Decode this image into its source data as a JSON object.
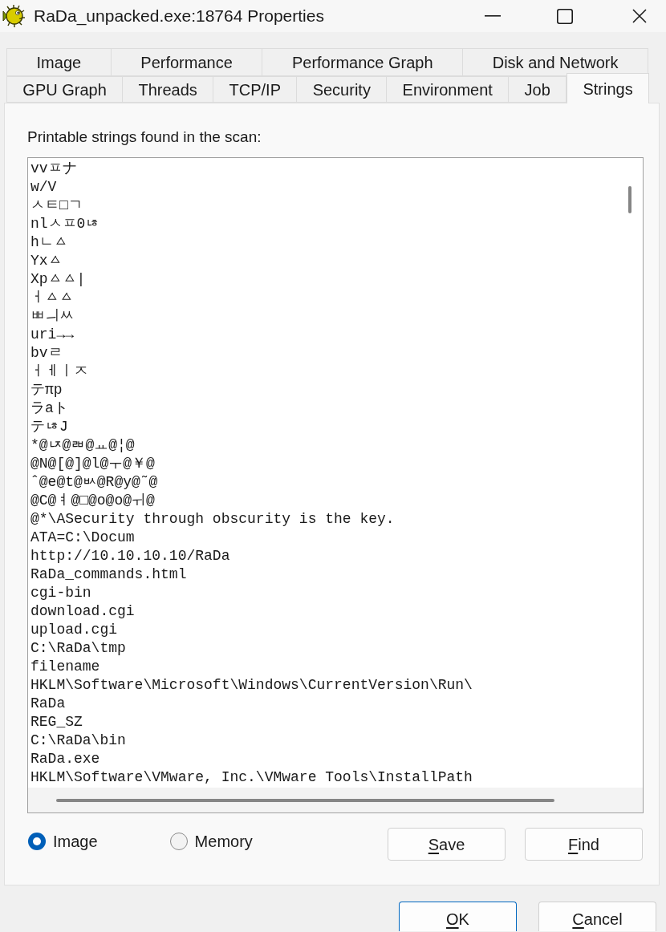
{
  "window": {
    "title": "RaDa_unpacked.exe:18764 Properties"
  },
  "tab_rows": [
    {
      "tabs": [
        {
          "label": "Image",
          "selected": false
        },
        {
          "label": "Performance",
          "selected": false
        },
        {
          "label": "Performance Graph",
          "selected": false
        },
        {
          "label": "Disk and Network",
          "selected": false
        }
      ]
    },
    {
      "tabs": [
        {
          "label": "GPU Graph",
          "selected": false
        },
        {
          "label": "Threads",
          "selected": false
        },
        {
          "label": "TCP/IP",
          "selected": false
        },
        {
          "label": "Security",
          "selected": false
        },
        {
          "label": "Environment",
          "selected": false
        },
        {
          "label": "Job",
          "selected": false
        },
        {
          "label": "Strings",
          "selected": true
        }
      ]
    }
  ],
  "strings_panel": {
    "heading": "Printable strings found in the scan:",
    "lines": [
      "vvㅍナ",
      "w/V",
      "ㅅㅌ□ㄱ",
      "nlㅅㅍ0ㄶ",
      "hㄴㅿ",
      "Yxㅿ",
      "Xpㅿㅿ|",
      "ㅓㅿㅿ",
      "ㅃㅢㅆ",
      "uri→→",
      "bvㄹ",
      "ㅓㅔㅣㅈ",
      "テπp",
      "ラaト",
      "テㄶJ",
      "*@ㄵ@ㄼ@ㅛ@¦@",
      "@N@[@]@l@ㅜ@￥@",
      "ˆ@e@t@ㅄ@R@y@˜@",
      "@C@ㅕ@□@o@o@ㅟ@",
      "@*\\ASecurity through obscurity is the key.",
      "ATA=C:\\Docum",
      "http://10.10.10.10/RaDa",
      "RaDa_commands.html",
      "cgi-bin",
      "download.cgi",
      "upload.cgi",
      "C:\\RaDa\\tmp",
      "filename",
      "HKLM\\Software\\Microsoft\\Windows\\CurrentVersion\\Run\\",
      "RaDa",
      "REG_SZ",
      "C:\\RaDa\\bin",
      "RaDa.exe",
      "HKLM\\Software\\VMware, Inc.\\VMware Tools\\InstallPath"
    ]
  },
  "source_options": [
    {
      "label": "Image",
      "selected": true
    },
    {
      "label": "Memory",
      "selected": false
    }
  ],
  "panel_buttons": [
    {
      "label": "Save",
      "mnemonic": true
    },
    {
      "label": "Find",
      "mnemonic": true
    }
  ],
  "dialog_buttons": [
    {
      "label": "OK",
      "mnemonic": true,
      "default": true
    },
    {
      "label": "Cancel",
      "mnemonic": true,
      "default": false
    }
  ]
}
